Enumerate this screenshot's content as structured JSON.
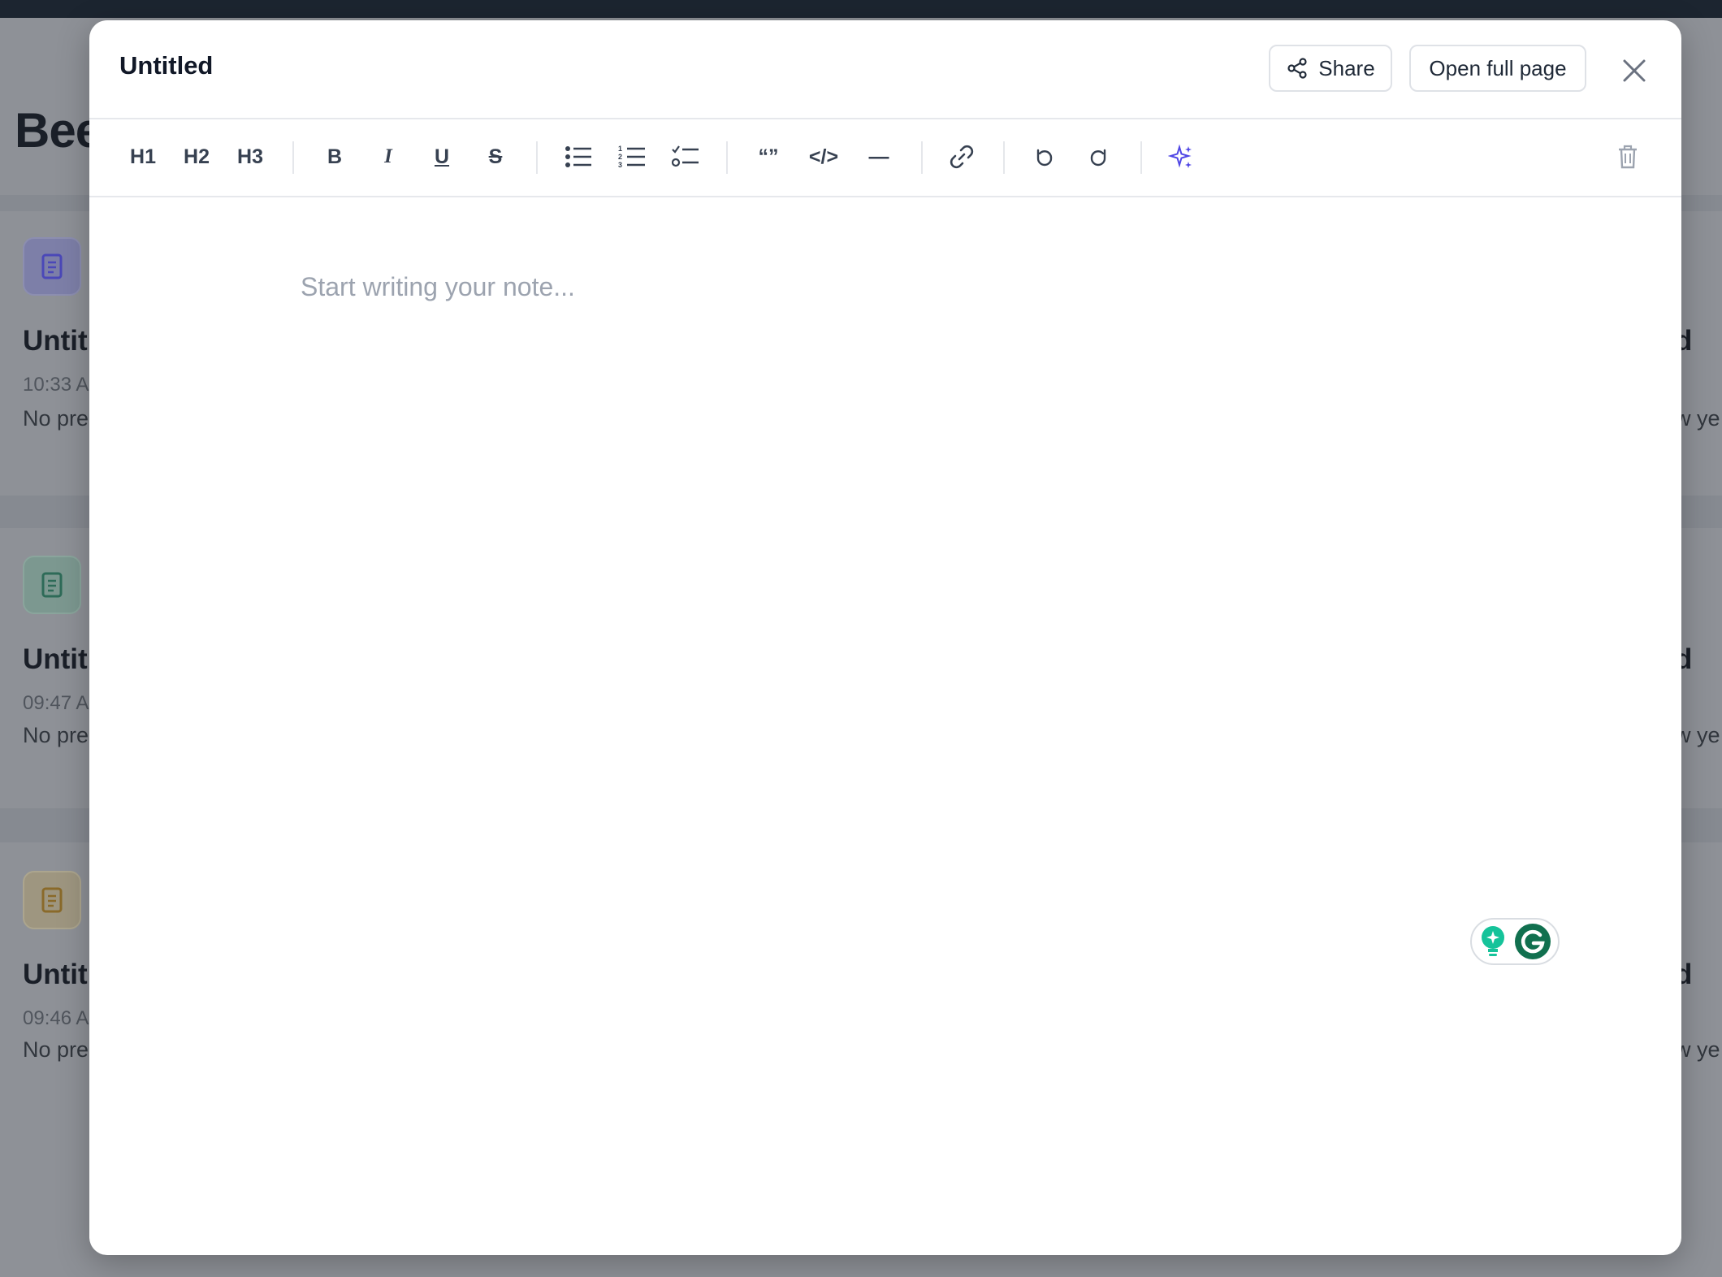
{
  "background": {
    "heading": "Bee",
    "cards": [
      {
        "title": "Untit",
        "time": "10:33 A",
        "preview": "No pre",
        "right_title": "d",
        "right_preview": "w ye",
        "icon": "document-icon",
        "icon_color": "#4b48b8",
        "icon_bg": "#7d7fa8"
      },
      {
        "title": "Untit",
        "time": "09:47 A",
        "preview": "No pre",
        "right_title": "d",
        "right_preview": "w ye",
        "icon": "document-icon",
        "icon_color": "#2e6b58",
        "icon_bg": "#7c9890"
      },
      {
        "title": "Untit",
        "time": "09:46 A",
        "preview": "No pre",
        "right_title": "d",
        "right_preview": "w ye",
        "icon": "document-icon",
        "icon_color": "#8a6a2a",
        "icon_bg": "#9e9680"
      }
    ]
  },
  "modal": {
    "title": "Untitled",
    "share_label": "Share",
    "open_full_label": "Open full page",
    "editor_placeholder": "Start writing your note..."
  },
  "toolbar": {
    "h1": "H1",
    "h2": "H2",
    "h3": "H3",
    "bold": "B",
    "italic": "I",
    "underline": "U",
    "strike": "S",
    "quote": "“”",
    "code": "</>",
    "divider": "—"
  },
  "colors": {
    "accent": "#4f46e5",
    "grammarly_green": "#15c39a",
    "grammarly_dark": "#11704f"
  }
}
